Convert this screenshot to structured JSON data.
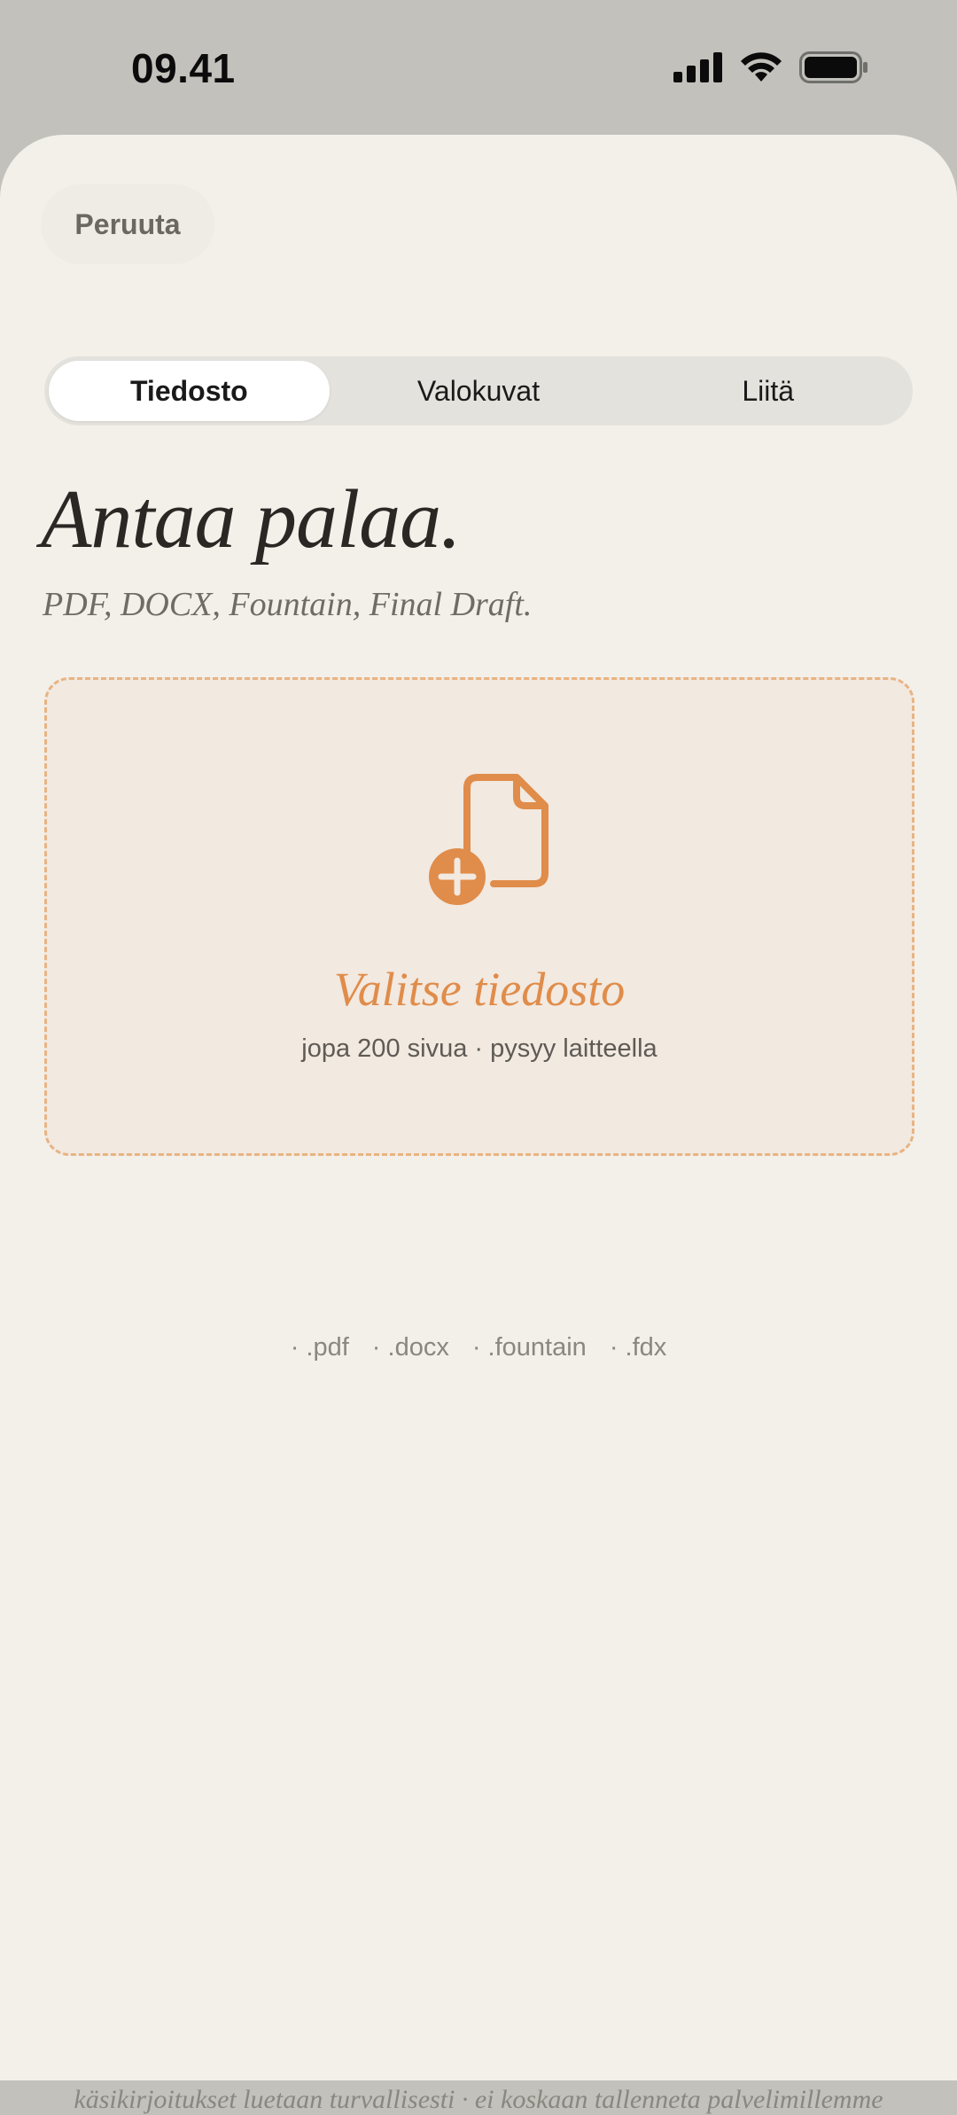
{
  "status": {
    "time": "09.41"
  },
  "sheet": {
    "cancel_label": "Peruuta"
  },
  "tabs": [
    {
      "label": "Tiedosto",
      "active": true
    },
    {
      "label": "Valokuvat",
      "active": false
    },
    {
      "label": "Liitä",
      "active": false
    }
  ],
  "header": {
    "title": "Antaa palaa.",
    "subtitle": "PDF, DOCX, Fountain, Final Draft."
  },
  "dropzone": {
    "icon": "document-plus-icon",
    "title": "Valitse tiedosto",
    "note": "jopa 200 sivua · pysyy laitteella"
  },
  "formats": [
    "· .pdf",
    "· .docx",
    "· .fountain",
    "· .fdx"
  ],
  "footer": {
    "text": "käsikirjoitukset luetaan turvallisesti · ei koskaan tallenneta palvelimillemme"
  },
  "colors": {
    "accent": "#e08c4a",
    "sheet_bg": "#f3f0ea",
    "dropzone_bg": "#f2e9e0",
    "dropzone_border": "#e8b382"
  }
}
